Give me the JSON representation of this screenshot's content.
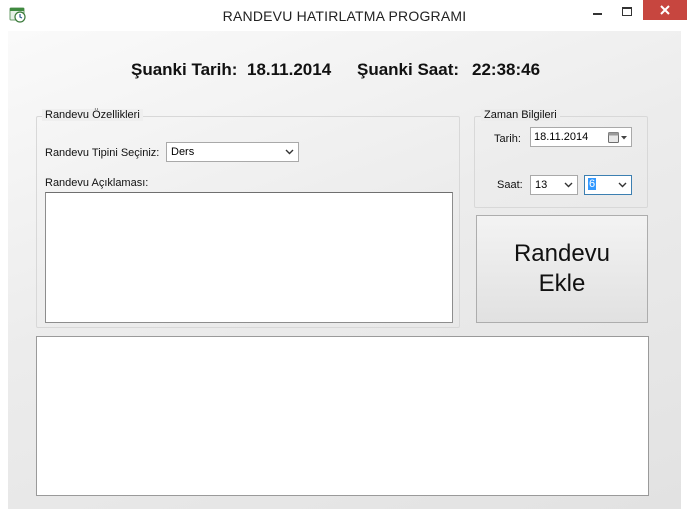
{
  "window": {
    "title": "RANDEVU HATIRLATMA PROGRAMI",
    "icon": "app-clock-icon",
    "controls": [
      "minimize-icon",
      "maximize-icon",
      "close-icon"
    ]
  },
  "now": {
    "date_label": "Şuanki Tarih:",
    "date_value": "18.11.2014",
    "time_label": "Şuanki Saat:",
    "time_value": "22:38:46"
  },
  "details": {
    "group_title": "Randevu Özellikleri",
    "type_label": "Randevu Tipini Seçiniz:",
    "type_value": "Ders",
    "description_label": "Randevu Açıklaması:",
    "description_value": ""
  },
  "timing": {
    "group_title": "Zaman Bilgileri",
    "date_label": "Tarih:",
    "date_value": "18.11.2014",
    "time_label": "Saat:",
    "hour_value": "13",
    "minute_value": "6"
  },
  "add_button": {
    "line1": "Randevu",
    "line2": "Ekle"
  },
  "colors": {
    "close_button": "#c7463f",
    "selection": "#3399ff"
  }
}
